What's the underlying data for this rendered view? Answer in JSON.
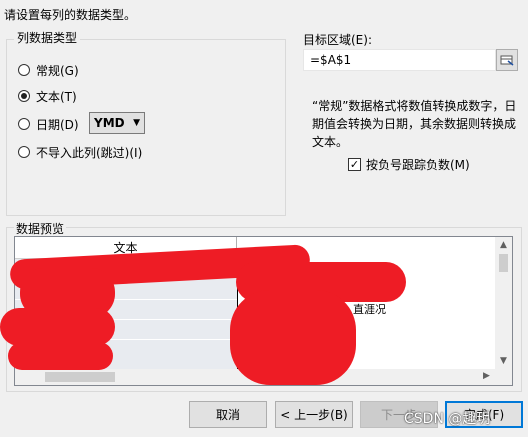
{
  "instruction": "请设置每列的数据类型。",
  "column_type_group": {
    "title": "列数据类型",
    "options": [
      {
        "label": "常规(G)",
        "checked": false
      },
      {
        "label": "文本(T)",
        "checked": true
      },
      {
        "label": "日期(D)",
        "checked": false
      },
      {
        "label": "不导入此列(跳过)(I)",
        "checked": false
      }
    ],
    "date_format": "YMD"
  },
  "target": {
    "label": "目标区域(E):",
    "value": "=$A$1"
  },
  "description": "“常规”数据格式将数值转换成数字，日期值会转换为日期，其余数据则转换成文本。",
  "negative_checkbox": {
    "label": "按负号跟踪负数(M)",
    "checked": true
  },
  "preview": {
    "title": "数据预览",
    "column_header": "文本",
    "partial_text": "直涯况"
  },
  "buttons": {
    "cancel": "取消",
    "back": "< 上一步(B)",
    "next": "下一步",
    "finish": "完成(F)"
  },
  "watermark": "CSDN @趣玥"
}
